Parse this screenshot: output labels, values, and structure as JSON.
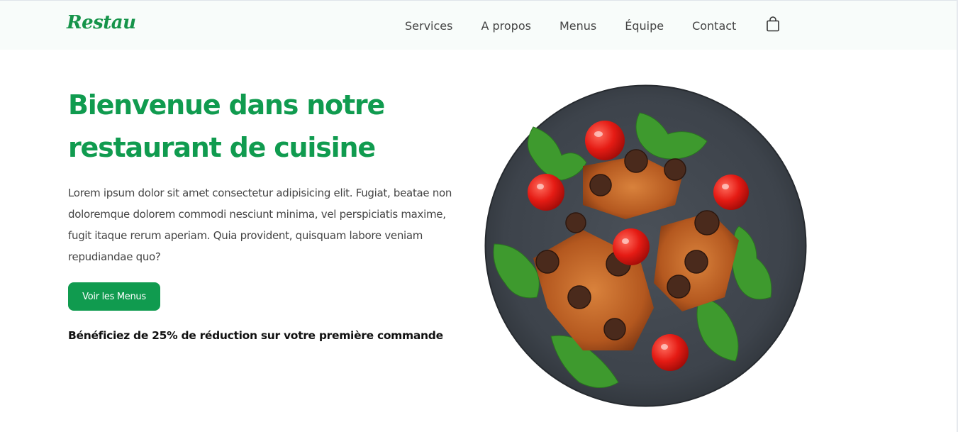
{
  "brand": {
    "logo_text": "Restau",
    "accent_color": "#109b4f"
  },
  "nav": {
    "items": [
      {
        "label": "Services"
      },
      {
        "label": "A propos"
      },
      {
        "label": "Menus"
      },
      {
        "label": "Équipe"
      },
      {
        "label": "Contact"
      }
    ],
    "cart_icon": "shopping-bag-icon"
  },
  "hero": {
    "title": "Bienvenue dans notre restaurant de cuisine",
    "description": "Lorem ipsum dolor sit amet consectetur adipisicing elit. Fugiat, beatae non doloremque dolorem commodi nesciunt minima, vel perspiciatis maxime, fugit itaque rerum aperiam. Quia provident, quisquam labore veniam repudiandae quo?",
    "cta_label": "Voir les Menus",
    "promo": "Bénéficiez de 25% de réduction sur votre première commande"
  }
}
